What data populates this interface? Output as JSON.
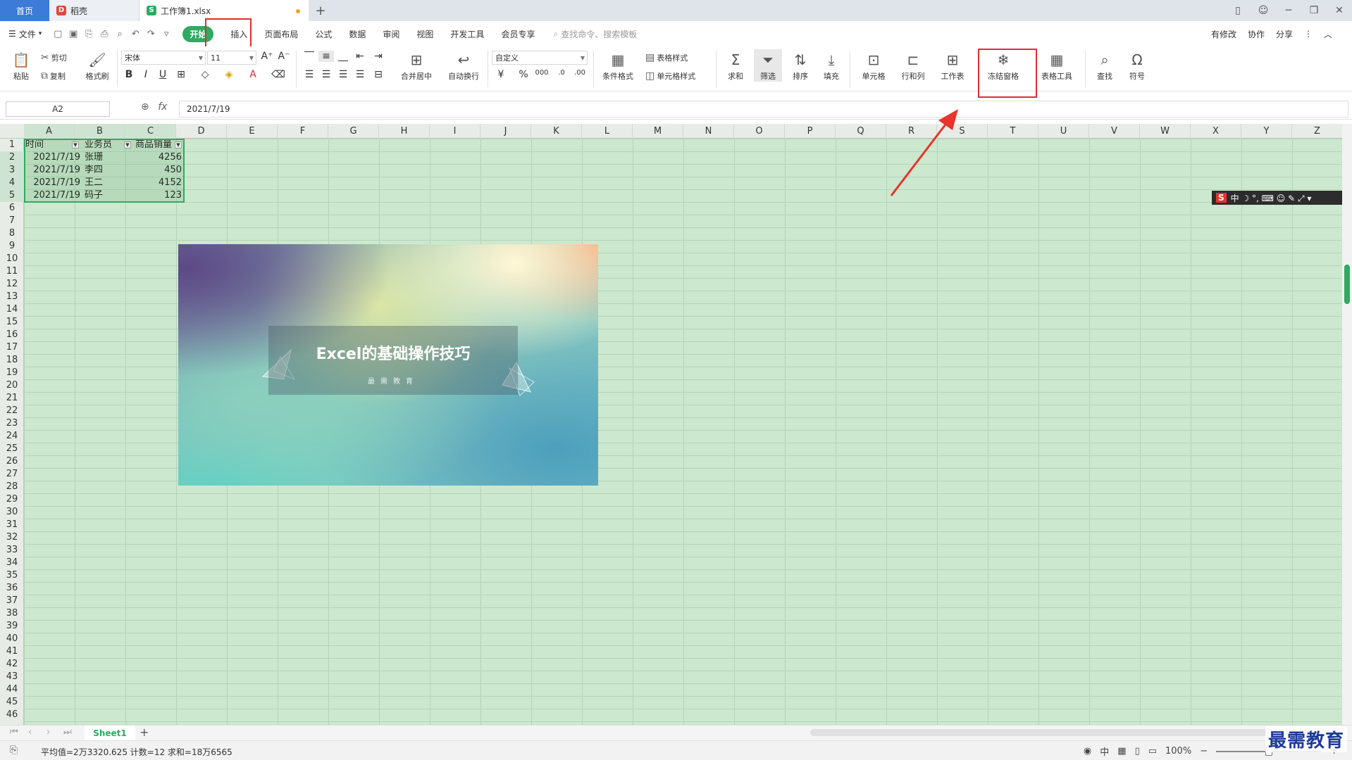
{
  "tabs": [
    {
      "label": "首页"
    },
    {
      "label": "稻壳"
    },
    {
      "label": "工作簿1.xlsx"
    }
  ],
  "menu": {
    "file": "文件",
    "items": [
      "开始",
      "插入",
      "页面布局",
      "公式",
      "数据",
      "审阅",
      "视图",
      "开发工具",
      "会员专享"
    ],
    "search_placeholder": "查找命令、搜索模板",
    "right": [
      "有修改",
      "协作",
      "分享"
    ]
  },
  "ribbon": {
    "paste": "粘贴",
    "cut": "剪切",
    "copy": "复制",
    "format_painter": "格式刷",
    "font_name": "宋体",
    "font_size": "11",
    "merge_center": "合并居中",
    "wrap_text": "自动换行",
    "number_format": "自定义",
    "table_style": "表格样式",
    "conditional_format": "条件格式",
    "cell_style": "单元格样式",
    "sum": "求和",
    "filter": "筛选",
    "sort": "排序",
    "fill": "填充",
    "cell": "单元格",
    "row_col": "行和列",
    "worksheet": "工作表",
    "freeze_panes": "冻结窗格",
    "table_tools": "表格工具",
    "find": "查找",
    "symbol": "符号"
  },
  "formula_bar": {
    "name_box": "A2",
    "fx": "fx",
    "value": "2021/7/19"
  },
  "columns": [
    "A",
    "B",
    "C",
    "D",
    "E",
    "F",
    "G",
    "H",
    "I",
    "J",
    "K",
    "L",
    "M",
    "N",
    "O",
    "P",
    "Q",
    "R",
    "S",
    "T",
    "U",
    "V",
    "W",
    "X",
    "Y",
    "Z"
  ],
  "rows": [
    "1",
    "2",
    "3",
    "4",
    "5",
    "6",
    "7",
    "8",
    "9",
    "10",
    "11",
    "12",
    "13",
    "14",
    "15",
    "16",
    "17",
    "18",
    "19",
    "20",
    "21",
    "22",
    "23",
    "24",
    "25",
    "26",
    "27",
    "28",
    "29",
    "30",
    "31",
    "32",
    "33",
    "34",
    "35",
    "36",
    "37",
    "38",
    "39",
    "40",
    "41",
    "42",
    "43",
    "44",
    "45",
    "46"
  ],
  "table": {
    "headers": [
      "时间",
      "业务员",
      "商品销量"
    ],
    "rows": [
      {
        "date": "2021/7/19",
        "name": "张珊",
        "qty": "4256"
      },
      {
        "date": "2021/7/19",
        "name": "李四",
        "qty": "450"
      },
      {
        "date": "2021/7/19",
        "name": "王二",
        "qty": "4152"
      },
      {
        "date": "2021/7/19",
        "name": "码子",
        "qty": "123"
      }
    ]
  },
  "banner": {
    "title": "Excel的基础操作技巧",
    "subtitle": "最需教育"
  },
  "sheet_tab": "Sheet1",
  "status": {
    "summary": "平均值=2万3320.625  计数=12  求和=18万6565",
    "zoom": "100%"
  },
  "watermark": "最需教育",
  "colors": {
    "accent": "#2eaa62",
    "highlight": "#e22d2d",
    "grid_bg": "#cce8cf",
    "home_tab": "#3d7bd8"
  }
}
